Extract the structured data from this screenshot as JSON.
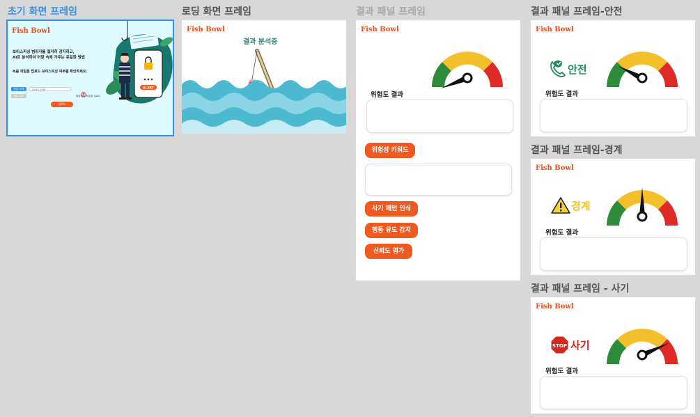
{
  "frames": {
    "initial": {
      "label": "초기 화면 프레임",
      "brand": "Fish Bowl",
      "desc_line1": "보이스피싱 범죄자를 철저히 감지하고,",
      "desc_line2": "AI로 분석하여 어항 속에 가두는 유일한 방법",
      "desc_line3": "녹음 파일을 업로드 보이스피싱 여부를 확인하세요.",
      "record_button": "녹음 시작",
      "stop_button": "녹음 중지",
      "file_placeholder": "0:00 / 0:00",
      "upload_hint": "음성파일 파일을 업로드",
      "upload_button": "업로드",
      "alert_text": "ALERT",
      "colors": {
        "accent": "#f05a20",
        "blue": "#2f93f0",
        "bg": "#dffbff"
      }
    },
    "loading": {
      "label": "로딩 화면 프레임",
      "brand": "Fish Bowl",
      "status": "결과 분석중"
    },
    "result": {
      "label": "결과 패널 프레임",
      "brand": "Fish Bowl",
      "risk_label": "위험도 결과",
      "keywords_button": "위험성 키워드",
      "pattern_button": "사기 패턴 인식",
      "behavior_button": "행동 유도 감지",
      "trust_button": "신뢰도 평가"
    },
    "safe": {
      "label": "결과 패널 프레임-안전",
      "brand": "Fish Bowl",
      "status": "안전",
      "risk_label": "위험도 결과"
    },
    "warning": {
      "label": "결과 패널 프레임-경계",
      "brand": "Fish Bowl",
      "status": "경계",
      "risk_label": "위험도 결과"
    },
    "fraud": {
      "label": "결과 패널 프레임 - 사기",
      "brand": "Fish Bowl",
      "status": "사기",
      "stop_sign": "STOP",
      "risk_label": "위험도 결과"
    }
  },
  "colors": {
    "gauge_green": "#2e8b3a",
    "gauge_yellow": "#f3c02c",
    "gauge_red": "#e02a28",
    "accent": "#f05a20",
    "safe": "#1f8a5b",
    "warning": "#f0c419",
    "fraud": "#d8261f"
  }
}
